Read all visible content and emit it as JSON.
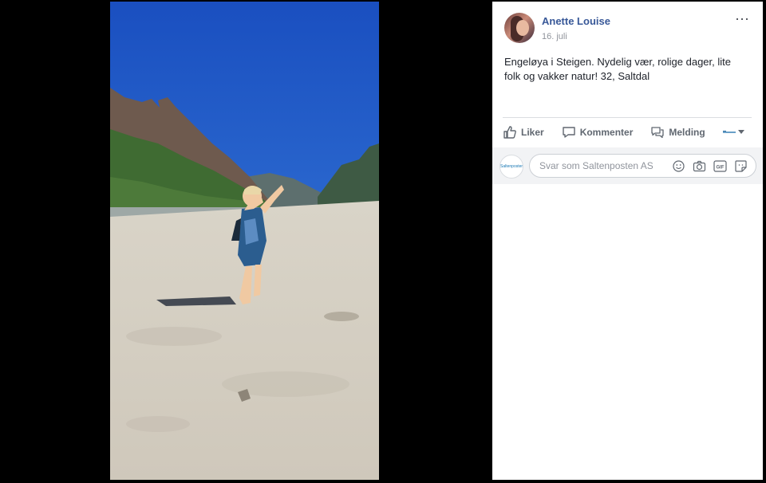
{
  "post": {
    "author": "Anette Louise",
    "date": "16. juli",
    "text": "Engeløya i Steigen. Nydelig vær, rolige dager, lite folk og vakker natur! 32, Saltdal",
    "more_icon": "⋯"
  },
  "actions": {
    "like_label": "Liker",
    "comment_label": "Kommenter",
    "message_label": "Melding"
  },
  "comment": {
    "page_avatar_text": "Saltenposten",
    "placeholder": "Svar som Saltenposten AS"
  },
  "icons": {
    "like": "thumbs-up-icon",
    "comment": "speech-bubble-icon",
    "message": "messenger-icon",
    "emoji": "smiley-icon",
    "camera": "camera-icon",
    "gif": "gif-icon",
    "sticker": "sticker-icon",
    "dropdown": "chevron-down-icon"
  },
  "colors": {
    "author_link": "#385898",
    "background": "#000000",
    "panel": "#ffffff",
    "sky": "#1f5bc4"
  }
}
